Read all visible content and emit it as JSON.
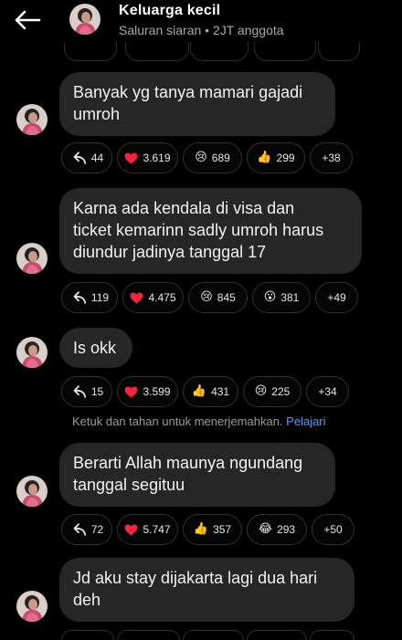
{
  "header": {
    "title": "Keluarga kecil",
    "subtitle": "Saluran siaran • 2JT anggota"
  },
  "translate_hint": {
    "text": "Ketuk dan tahan untuk menerjemahkan.",
    "link": "Pelajari"
  },
  "messages": [
    {
      "text": "Banyak yg tanya mamari gajadi\numroh",
      "reactions": {
        "reply": "44",
        "heart": "3.619",
        "second": "689",
        "third": "299",
        "more": "+38"
      },
      "emojis": {
        "second": "😢",
        "third": "👍"
      }
    },
    {
      "text": "Karna ada kendala di visa dan\nticket kemarinn sadly umroh harus\ndiundur jadinya tanggal 17",
      "reactions": {
        "reply": "119",
        "heart": "4.475",
        "second": "845",
        "third": "381",
        "more": "+49"
      },
      "emojis": {
        "second": "😢",
        "third": "😮"
      }
    },
    {
      "text": "Is okk",
      "reactions": {
        "reply": "15",
        "heart": "3.599",
        "second": "431",
        "third": "225",
        "more": "+34"
      },
      "emojis": {
        "second": "👍",
        "third": "😢"
      }
    },
    {
      "text": "Berarti Allah maunya ngundang\ntanggal segituu",
      "reactions": {
        "reply": "72",
        "heart": "5.747",
        "second": "357",
        "third": "293",
        "more": "+50"
      },
      "emojis": {
        "second": "👍",
        "third": "😂"
      }
    },
    {
      "text": "Jd aku stay dijakarta lagi dua hari\ndeh"
    }
  ]
}
